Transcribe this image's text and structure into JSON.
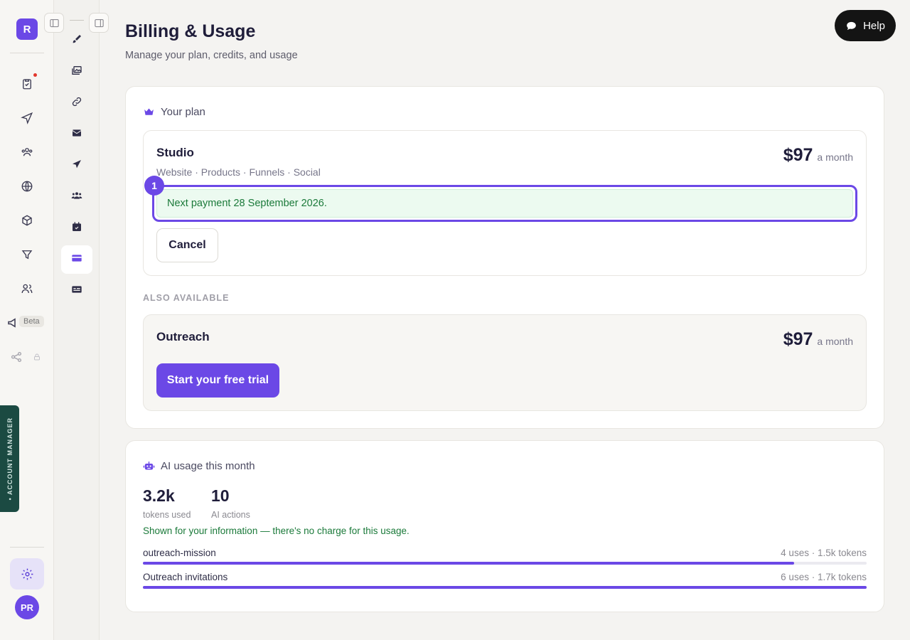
{
  "rail": {
    "logo_letter": "R",
    "beta_label": "Beta",
    "account_manager_label": "• ACCOUNT MANAGER",
    "avatar_initials": "PR"
  },
  "page": {
    "title": "Billing & Usage",
    "subtitle": "Manage your plan, credits, and usage"
  },
  "help": {
    "label": "Help"
  },
  "plan_card": {
    "header": "Your plan",
    "current": {
      "name": "Studio",
      "features": "Website · Products · Funnels · Social",
      "price": "$97",
      "period": "a month",
      "payment_note": "Next payment 28 September 2026.",
      "badge": "1",
      "cancel_label": "Cancel"
    },
    "also_available_label": "ALSO AVAILABLE",
    "other": {
      "name": "Outreach",
      "price": "$97",
      "period": "a month",
      "trial_label": "Start your free trial"
    }
  },
  "usage_card": {
    "header": "AI usage this month",
    "stats": [
      {
        "value": "3.2k",
        "label": "tokens used"
      },
      {
        "value": "10",
        "label": "AI actions"
      }
    ],
    "note": "Shown for your information — there's no charge for this usage.",
    "rows": [
      {
        "name": "outreach-mission",
        "meta": "4 uses · 1.5k tokens",
        "share": 0.9
      },
      {
        "name": "Outreach invitations",
        "meta": "6 uses · 1.7k tokens",
        "share": 1.0
      }
    ]
  },
  "colors": {
    "accent": "#6b48e6",
    "success_text": "#1b7a3a",
    "success_bg": "#ecfaf0"
  }
}
